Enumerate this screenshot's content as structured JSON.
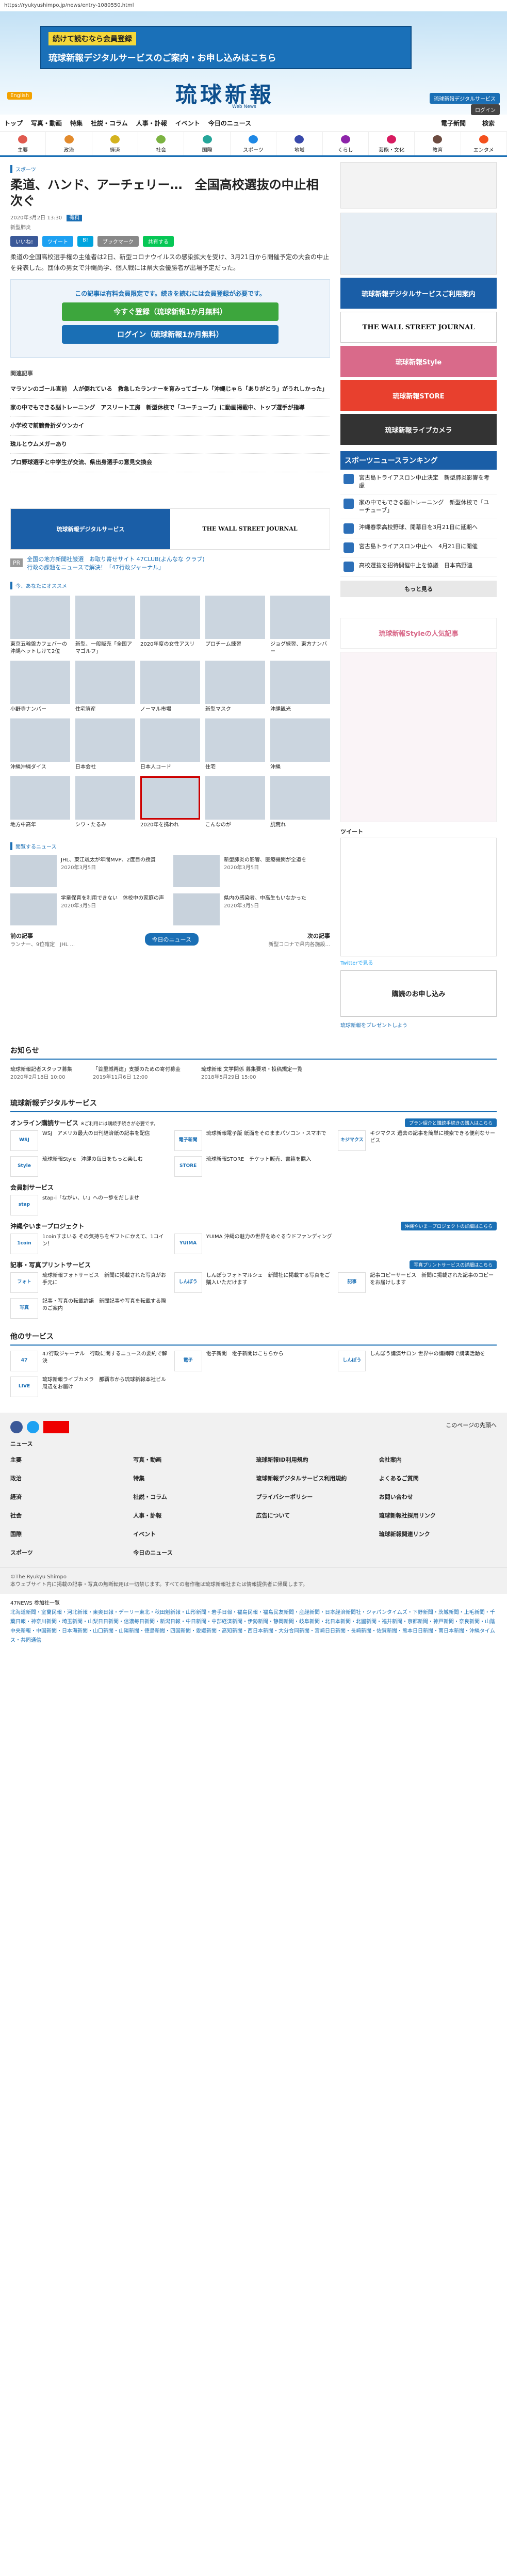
{
  "url": "https://ryukyushimpo.jp/news/entry-1080550.html",
  "banner": {
    "line1": "続けて読むなら会員登録",
    "line2": "琉球新報デジタルサービスのご案内・お申し込みはこちら"
  },
  "header": {
    "english": "English",
    "logo": "琉球新報",
    "logo_sub": "Web News",
    "digital_btn": "琉球新報デジタルサービス",
    "login_btn": "ログイン"
  },
  "gnav": [
    "トップ",
    "写真・動画",
    "特集",
    "社説・コラム",
    "人事・訃報",
    "イベント",
    "今日のニュース"
  ],
  "gnav_right": [
    "電子新聞",
    "検索"
  ],
  "catnav": [
    "主要",
    "政治",
    "経済",
    "社会",
    "国際",
    "スポーツ",
    "地域",
    "くらし",
    "芸能・文化",
    "教育",
    "エンタメ"
  ],
  "article": {
    "category": "スポーツ",
    "title": "柔道、ハンド、アーチェリー…　全国高校選抜の中止相次ぐ",
    "badge": "有料",
    "date": "2020年3月2日 13:30",
    "author": "新型肺炎",
    "share": [
      "いいね!",
      "ツイート",
      "B!",
      "ブックマーク",
      "共有する"
    ],
    "lead": "柔道の全国高校選手権の主催者は2日、新型コロナウイルスの感染拡大を受け、3月21日から開催予定の大会の中止を発表した。団体の男女で沖縄尚学、個人戦には県大会優勝者が出場予定だった。",
    "paywall_text": "この記事は有料会員限定です。続きを読むには会員登録が必要です。",
    "register_btn": "今すぐ登録（琉球新報1か月無料）",
    "login_btn": "ログイン（琉球新報1か月無料）"
  },
  "related": {
    "heading": "関連記事",
    "items": [
      "マラソンのゴール直前　人が倒れている　救急したランナーを育みってゴール「沖縄じゃら「ありがとう」がうれしかった」",
      "家の中でもできる脳トレーニング　アスリート工房　新型休校で「ユーチューブ」に動画掲載中、トップ選手が指導",
      "小学校で前腕骨折ダウンカイ",
      "珠ルとウムメガーあり",
      "プロ野球選手と中学生が交流、県出身選手の意見交換会"
    ]
  },
  "ad_banner": {
    "left": "琉球新報デジタルサービス",
    "right": "THE WALL STREET JOURNAL"
  },
  "pr": {
    "label": "PR",
    "text": "全国の地方新聞社厳選　お取り寄せサイト 47CLUB(よんなな クラブ)",
    "sub": "行政の課題をニュースで解決！「47行政ジャーナル」"
  },
  "reco": {
    "heading": "今、あなたにオススメ",
    "items": [
      "東京五輪盤カフェバーの沖縄ヘットしけて2位",
      "新型、一般販売「全国アマゴルフ」",
      "2020年度の女性アスリ",
      "プロチーム練習",
      "ジョグ練習、東方ナンバー",
      "小野寺ナンバー",
      "住宅資産",
      "ノーマル市場",
      "新型マスク",
      "沖縄観光",
      "沖縄沖縄ダイス",
      "日本会社",
      "日本人コード",
      "住宅",
      "沖縄",
      "地方中高年",
      "シワ・たるみ",
      "2020年を携われ",
      "こんなのが",
      "肌荒れ"
    ]
  },
  "sidebar": {
    "wsj_text": "琉球新報デジタルサービスご利用案内",
    "wsj": "THE WALL STREET JOURNAL",
    "style": "琉球新報Style",
    "store": "琉球新報STORE",
    "library": "琉球新報ライブカメラ",
    "rank_title": "スポーツニュースランキング",
    "rank": [
      "宮古島トライアスロン中止決定　新型肺炎影響を考慮",
      "家の中でもできる脳トレーニング　新型休校で「ユーチューブ」",
      "沖縄春季高校野球、開幕日を3月21日に延期へ",
      "宮古島トライアスロン中止へ　4月21日に開催",
      "高校選抜を招待開催中止を協議　日本高野連"
    ],
    "more": "もっと見る",
    "style_rank": "琉球新報Styleの人気記事",
    "twitter": "ツイート",
    "follow": "Twitterで見る",
    "subscribe": "購読のお申し込み",
    "gift": "琉球新報をプレゼントしよう"
  },
  "today": {
    "heading": "閲覧するニュース",
    "items": [
      {
        "t": "JHL、東江颯太が年間MVP、2度目の授賞　",
        "d": "2020年3月5日"
      },
      {
        "t": "新型肺炎の影響、医療機関が全道を",
        "d": "2020年3月5日"
      },
      {
        "t": "学童保育を利用できない　休校中の家庭の声",
        "d": "2020年3月5日"
      },
      {
        "t": "県内の感染者、中高生もいなかった",
        "d": "2020年3月5日"
      }
    ],
    "prev": "前の記事",
    "prev_title": "ランナー、9位確定　JHL ...",
    "today": "今日のニュース",
    "next": "次の記事",
    "next_title": "新型コロナで県内各施設..."
  },
  "info": {
    "heading": "お知らせ",
    "items": [
      {
        "t": "琉球新報記者スタッフ募集",
        "d": "2020年2月18日 10:00"
      },
      {
        "t": "「首里城再建」支援のための寄付募金",
        "d": "2019年11月6日 12:00"
      },
      {
        "t": "琉球新報 文学関係 募集要項・投稿規定一覧",
        "d": "2018年5月29日 15:00"
      }
    ]
  },
  "services": {
    "heading": "琉球新報デジタルサービス",
    "online_heading": "オンライン購読サービス",
    "online_sub": "※ご利用には購読手続きが必要です。",
    "online_tag": "プラン紹介と購読手続きの購入はこちら",
    "online": [
      {
        "logo": "WSJ",
        "t": "WSJ　アメリカ最大の日刊経済紙の記事を配信"
      },
      {
        "logo": "電子新聞",
        "t": "琉球新報電子版 紙面をそのままパソコン・スマホで"
      },
      {
        "logo": "キジマクス",
        "t": "キジマクス 過去の記事を簡単に検索できる便利なサービス"
      },
      {
        "logo": "Style",
        "t": "琉球新報Style　沖縄の毎日をもっと楽しむ"
      },
      {
        "logo": "STORE",
        "t": "琉球新報STORE　チケット販売、書籍を購入"
      }
    ],
    "member_heading": "会員制サービス",
    "member": [
      {
        "logo": "stap",
        "t": "stap-i「ながい、い」へのー歩をだしませ"
      }
    ],
    "okinawa_heading": "沖縄やいまープロジェクト",
    "okinawa_tag": "沖縄やいまープロジェクトの詳細はこちら",
    "okinawa": [
      {
        "logo": "1coin",
        "t": "1coinすまいる その気持ちをギフトにかえて、1コイン！"
      },
      {
        "logo": "YUIMA",
        "t": "YUIMA 沖縄の魅力の世界をめぐるウドファンディング"
      }
    ],
    "print_heading": "記事・写真プリントサービス",
    "print_tag": "写真プリントサービスの詳細はこちら",
    "print": [
      {
        "logo": "フォト",
        "t": "琉球新報フォトサービス　新聞に掲載された写真がお手元に"
      },
      {
        "logo": "しんぽう",
        "t": "しんぽうフォトマルシェ　新聞社に掲載する写真をご購入いただけます"
      },
      {
        "logo": "記事",
        "t": "記事コピーサービス　新聞に掲載された記事のコピーをお届けします"
      },
      {
        "logo": "写真",
        "t": "記事・写真の転載許諾　新聞記事や写真を転載する際のご案内"
      }
    ],
    "other_heading": "他のサービス",
    "other": [
      {
        "logo": "47",
        "t": "47行政ジャーナル　行政に関するニュースの要約で解決"
      },
      {
        "logo": "電子",
        "t": "電子新聞　電子新聞はこちらから"
      },
      {
        "logo": "しんぽう",
        "t": "しんぽう講演サロン 世界中の講師陣で講演活動を"
      },
      {
        "logo": "LIVE",
        "t": "琉球新報ライブカメラ　那覇市から琉球新報本社ビル周辺をお届け"
      }
    ]
  },
  "footer": {
    "top_link": "このページの先頭へ",
    "news": "ニュース",
    "cats": [
      "主要",
      "政治",
      "経済",
      "社会",
      "国際",
      "スポーツ",
      "地域",
      "くらし",
      "芸能・文化",
      "教育",
      "エンタメ"
    ],
    "links": [
      "写真・動画",
      "特集",
      "社説・コラム",
      "人事・訃報",
      "イベント",
      "今日のニュース",
      "琉球新報ID利用規約",
      "琉球新報デジタルサービス利用規約",
      "プライバシーポリシー",
      "広告について",
      "会社案内",
      "よくあるご質問",
      "お問い合わせ",
      "琉球新報社採用リンク",
      "琉球新報関連リンク"
    ],
    "copyright": "©The Ryukyu Shimpo",
    "copy_note": "本ウェブサイト内に掲載の記事・写真の無断転用は一切禁じます。すべての著作権は琉球新報社または情報提供者に帰属します。",
    "n47": "47NEWS 参加社一覧",
    "n47_list": "北海道新聞・室蘭民報・河北新報・東奥日報・デーリー東北・秋田魁新報・山形新聞・岩手日報・福島民報・福島民友新聞・産経新聞・日本経済新聞社・ジャパンタイムズ・下野新聞・茨城新聞・上毛新聞・千葉日報・神奈川新聞・埼玉新聞・山梨日日新聞・信濃毎日新聞・新潟日報・中日新聞・中部経済新聞・伊勢新聞・静岡新聞・岐阜新聞・北日本新聞・北國新聞・福井新聞・京都新聞・神戸新聞・奈良新聞・山陰中央新報・中国新聞・日本海新聞・山口新聞・山陽新聞・徳島新聞・四国新聞・愛媛新聞・高知新聞・西日本新聞・大分合同新聞・宮崎日日新聞・長崎新聞・佐賀新聞・熊本日日新聞・南日本新聞・沖縄タイムス・共同通信"
  }
}
